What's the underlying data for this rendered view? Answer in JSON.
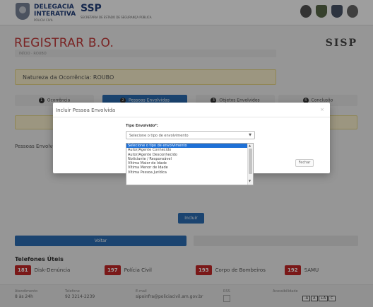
{
  "header": {
    "brand_line1": "DELEGACIA",
    "brand_line2": "INTERATIVA",
    "brand_sub": "PÓLICIA CIVIL",
    "ssp": "SSP",
    "ssp_sub": "SECRETARIA DE ESTADO DE SEGURANÇA PÚBLICA"
  },
  "page": {
    "title": "REGISTRAR B.O.",
    "sisp": "SISP",
    "breadcrumb": "INÍCIO · ROUBO",
    "natureza": "Natureza da Ocorrência: ROUBO"
  },
  "steps": [
    {
      "num": "1",
      "label": "Ocorrência"
    },
    {
      "num": "2",
      "label": "Pessoas Envolvidas"
    },
    {
      "num": "3",
      "label": "Objetos Envolvidos"
    },
    {
      "num": "4",
      "label": "Conclusão"
    }
  ],
  "section_label": "Pessoas Envolvidas",
  "modal": {
    "title": "Incluir Pessoa Envolvida",
    "close": "×",
    "field_label": "Tipo Envolvido*:",
    "select_value": "Selecione o tipo de envolvimento",
    "close_button": "Fechar"
  },
  "dropdown_options": [
    "Selecione o tipo de envolvimento",
    "Autor/Agente Conhecido",
    "Autor/Agente Desconhecido",
    "Noticiante / Responsável",
    "Vítima Maior de Idade",
    "Vítima Menor de Idade",
    "Vítima Pessoa Jurídica"
  ],
  "buttons": {
    "incluir": "Incluir",
    "voltar": "Voltar"
  },
  "telefones": {
    "title": "Telefones Úteis",
    "items": [
      {
        "num": "181",
        "label": "Disk-Denúncia"
      },
      {
        "num": "197",
        "label": "Polícia Civil"
      },
      {
        "num": "193",
        "label": "Corpo de Bombeiros"
      },
      {
        "num": "192",
        "label": "SAMU"
      }
    ]
  },
  "footer": {
    "atendimento_label": "Atendimento",
    "atendimento_value": "8 às 24h",
    "telefone_label": "Telefone",
    "telefone_value": "92 3214-2239",
    "email_label": "E-mail",
    "email_value": "sipoinfra@policiacivil.am.gov.br",
    "rss_label": "RSS",
    "acess_label": "Acessibilidade",
    "acess_buttons": [
      "-A",
      "A",
      "+A",
      "C"
    ]
  },
  "colors": {
    "primary_blue": "#2d6eb5",
    "title_red": "#c43b3b",
    "tel_red": "#c62828",
    "notice_yellow": "#fcf3cf"
  }
}
